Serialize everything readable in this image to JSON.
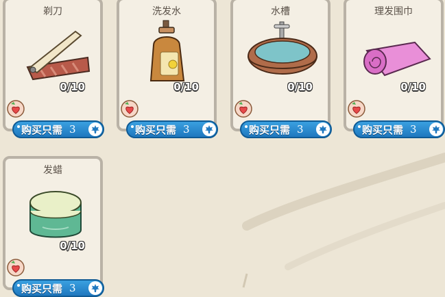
{
  "items": [
    {
      "name": "剃刀",
      "qty": "0/10",
      "buy_label": "购买只需",
      "price": "3",
      "icon": "razor-icon"
    },
    {
      "name": "洗发水",
      "qty": "0/10",
      "buy_label": "购买只需",
      "price": "3",
      "icon": "shampoo-bottle-icon"
    },
    {
      "name": "水槽",
      "qty": "0/10",
      "buy_label": "购买只需",
      "price": "3",
      "icon": "sink-icon"
    },
    {
      "name": "理发围巾",
      "qty": "0/10",
      "buy_label": "购买只需",
      "price": "3",
      "icon": "towel-icon"
    },
    {
      "name": "发蜡",
      "qty": "0/10",
      "buy_label": "购买只需",
      "price": "3",
      "icon": "hair-wax-jar-icon"
    }
  ],
  "colors": {
    "background": "#ede6d6",
    "card": "#f4efe4",
    "card_border": "#b9b2a6",
    "button": "#1f78bf",
    "heart": "#e64a4a"
  }
}
